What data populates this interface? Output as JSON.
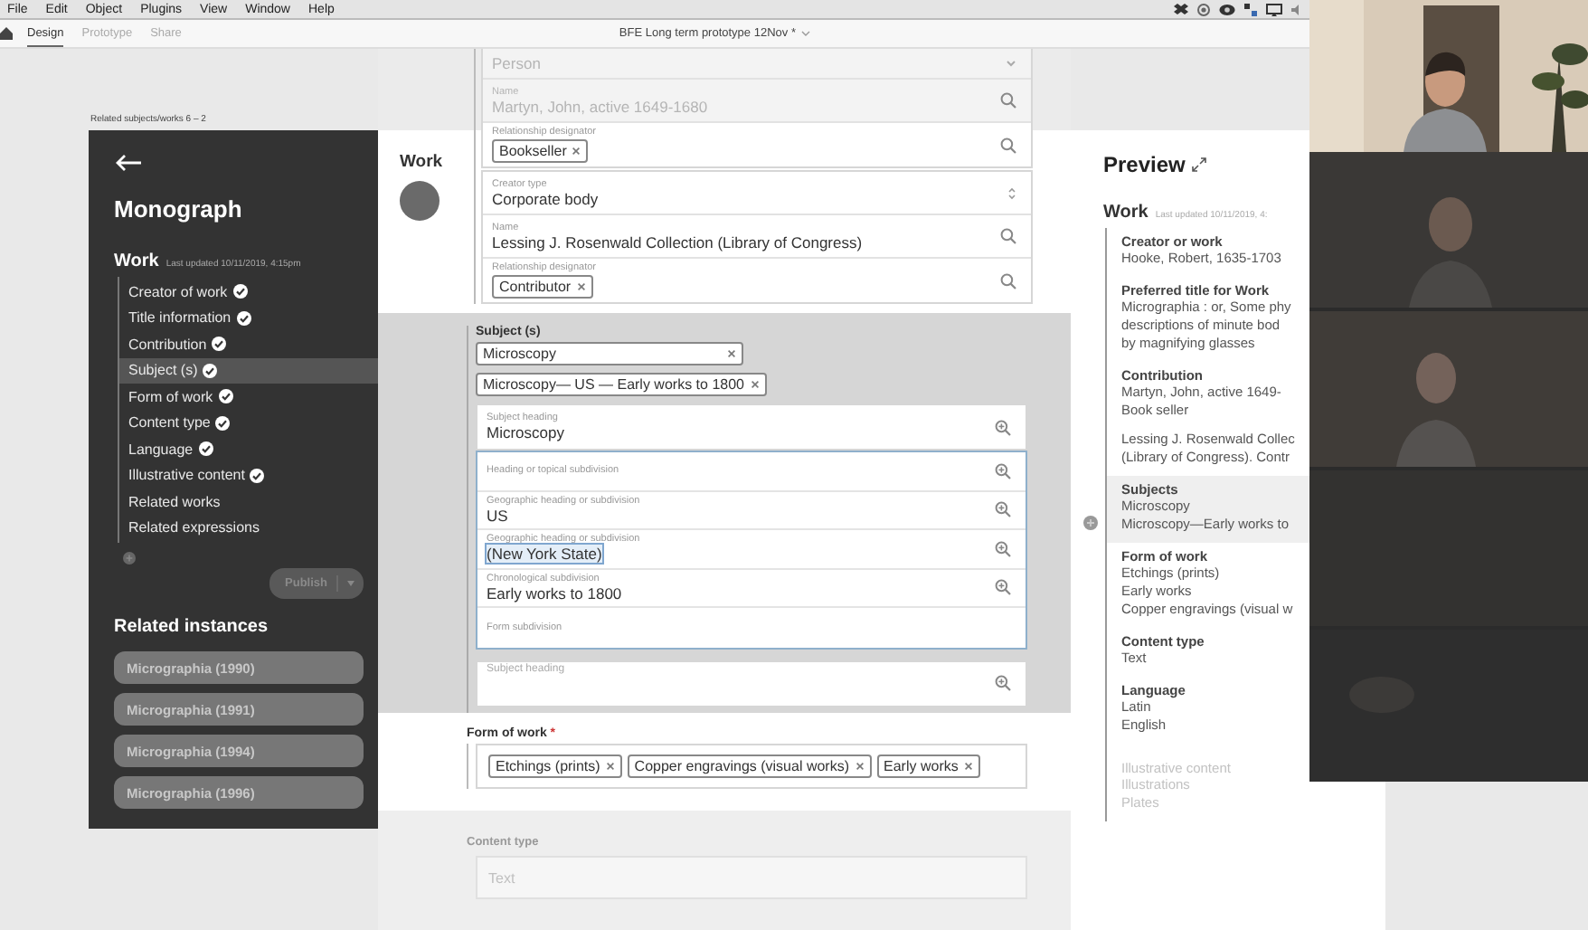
{
  "menu_bar": {
    "items": [
      "File",
      "Edit",
      "Object",
      "Plugins",
      "View",
      "Window",
      "Help"
    ]
  },
  "toolbar": {
    "tabs": [
      {
        "label": "Design",
        "selected": true
      },
      {
        "label": "Prototype",
        "selected": false
      },
      {
        "label": "Share",
        "selected": false
      }
    ],
    "document_title": "BFE Long term prototype 12Nov *"
  },
  "artboard_label": "Related subjects/works 6 – 2",
  "sidebar": {
    "title": "Monograph",
    "section": "Work",
    "updated": "Last updated 10/11/2019, 4:15pm",
    "items": [
      {
        "label": "Creator of work",
        "done": true,
        "selected": false
      },
      {
        "label": "Title information",
        "done": true,
        "selected": false
      },
      {
        "label": "Contribution",
        "done": true,
        "selected": false
      },
      {
        "label": "Subject (s)",
        "done": true,
        "selected": true
      },
      {
        "label": "Form of work",
        "done": true,
        "selected": false
      },
      {
        "label": "Content type",
        "done": true,
        "selected": false
      },
      {
        "label": "Language",
        "done": true,
        "selected": false
      },
      {
        "label": "Illustrative content",
        "done": true,
        "selected": false
      },
      {
        "label": "Related works",
        "done": false,
        "selected": false
      },
      {
        "label": "Related expressions",
        "done": false,
        "selected": false
      }
    ],
    "publish_button": "Publish",
    "instances_title": "Related instances",
    "instances": [
      "Micrographia (1990)",
      "Micrographia (1991)",
      "Micrographia (1994)",
      "Micrographia (1996)"
    ]
  },
  "editor": {
    "heading": "Work",
    "cards": [
      {
        "rows": [
          {
            "kind": "select",
            "value": "Person",
            "disabled": true
          },
          {
            "kind": "search",
            "label": "Name",
            "value": "Martyn, John, active 1649-1680",
            "disabled": true
          },
          {
            "kind": "chips",
            "label": "Relationship designator",
            "chips": [
              "Bookseller"
            ],
            "disabled": false
          }
        ]
      },
      {
        "rows": [
          {
            "kind": "stepper",
            "label": "Creator type",
            "value": "Corporate body",
            "disabled": false
          },
          {
            "kind": "search",
            "label": "Name",
            "value": "Lessing J. Rosenwald Collection (Library of Congress)",
            "disabled": false
          },
          {
            "kind": "chips",
            "label": "Relationship designator",
            "chips": [
              "Contributor"
            ],
            "disabled": false
          }
        ]
      }
    ],
    "subjects": {
      "title": "Subject (s)",
      "chips": [
        "Microscopy",
        "Microscopy— US — Early works to 1800"
      ],
      "heading_field": {
        "label": "Subject heading",
        "value": "Microscopy"
      },
      "subdivisions": [
        {
          "label": "Heading or topical subdivision",
          "selected": false
        },
        {
          "label": "Geographic heading or subdivision",
          "value": "US",
          "selected": false
        },
        {
          "label": "Geographic heading or subdivision",
          "value": "(New York State)",
          "selected": true
        },
        {
          "label": "Chronological subdivision",
          "value": "Early works to 1800",
          "selected": false
        },
        {
          "label": "Form subdivision",
          "selected": false
        }
      ],
      "new_heading": {
        "placeholder": "Subject heading"
      }
    },
    "form_of_work": {
      "title": "Form of work",
      "required_mark": "*",
      "chips": [
        "Etchings (prints)",
        "Copper engravings (visual works)",
        "Early works"
      ]
    },
    "content_type": {
      "title": "Content type",
      "placeholder": "Text"
    }
  },
  "preview": {
    "title": "Preview",
    "section": "Work",
    "updated": "Last updated 10/11/2019, 4:",
    "groups": [
      {
        "heading": "Creator or work",
        "paragraphs": [
          [
            "Hooke, Robert, 1635-1703"
          ]
        ],
        "highlighted": false,
        "dimmed": false
      },
      {
        "heading": "Preferred title for Work",
        "paragraphs": [
          [
            "Micrographia : or, Some phy",
            "descriptions of minute bod",
            "by magnifying glasses"
          ]
        ],
        "highlighted": false,
        "dimmed": false
      },
      {
        "heading": "Contribution",
        "paragraphs": [
          [
            "Martyn, John, active 1649-",
            "Book seller"
          ],
          [
            "Lessing J. Rosenwald Collec",
            "(Library of Congress). Contr"
          ]
        ],
        "highlighted": false,
        "dimmed": false
      },
      {
        "heading": "Subjects",
        "paragraphs": [
          [
            "Microscopy",
            "Microscopy—Early works to"
          ]
        ],
        "highlighted": true,
        "dimmed": false
      },
      {
        "heading": "Form of work",
        "paragraphs": [
          [
            "Etchings (prints)",
            "Early works",
            "Copper engravings (visual w"
          ]
        ],
        "highlighted": false,
        "dimmed": false
      },
      {
        "heading": "Content type",
        "paragraphs": [
          [
            "Text"
          ]
        ],
        "highlighted": false,
        "dimmed": false
      },
      {
        "heading": "Language",
        "paragraphs": [
          [
            "Latin",
            "English"
          ]
        ],
        "highlighted": false,
        "dimmed": false
      },
      {
        "heading": "Illustrative content",
        "paragraphs": [
          [
            "Illustrations",
            "Plates"
          ]
        ],
        "highlighted": false,
        "dimmed": true
      }
    ]
  }
}
